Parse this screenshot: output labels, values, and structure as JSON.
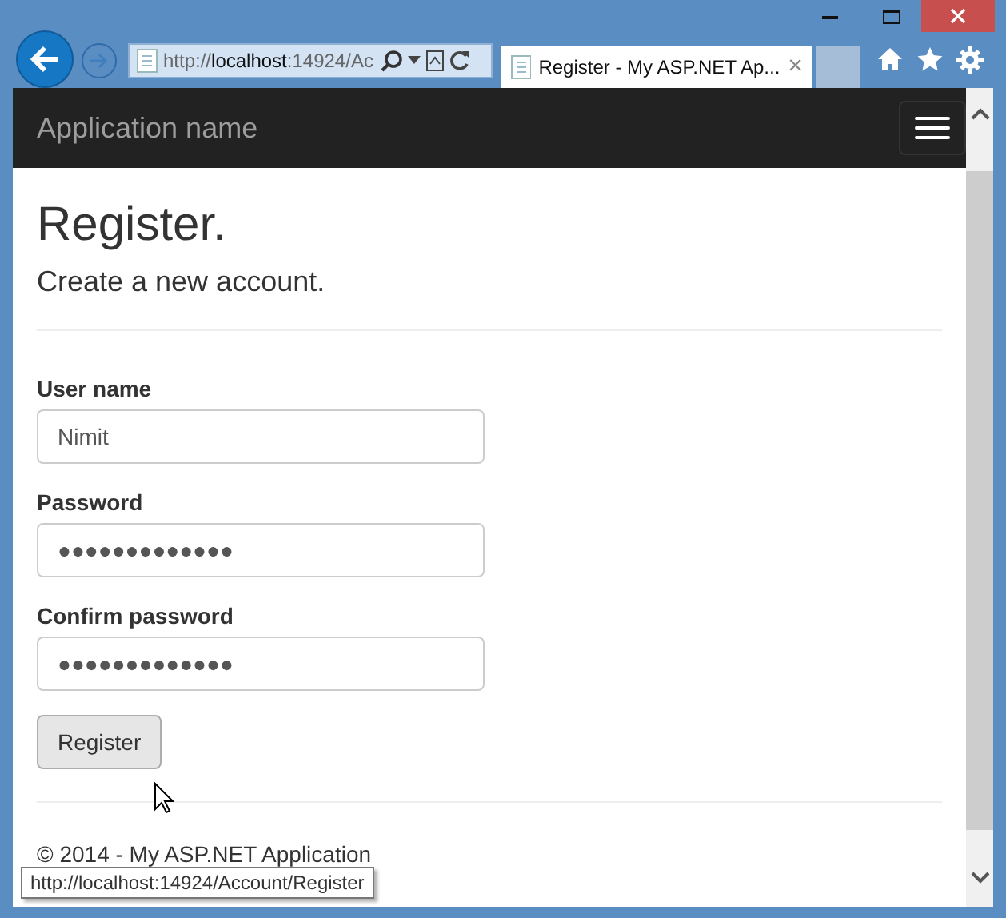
{
  "browser": {
    "address": "http://**localhost**:14924/Ac",
    "tab_title": "Register - My ASP.NET Ap...",
    "tab_close": "×",
    "status_url": "http://localhost:14924/Account/Register"
  },
  "navbar": {
    "brand": "Application name"
  },
  "page": {
    "title": "Register.",
    "subtitle": "Create a new account.",
    "fields": [
      {
        "label": "User name",
        "value": "Nimit"
      },
      {
        "label": "Password",
        "value": "●●●●●●●●●●●●●"
      },
      {
        "label": "Confirm password",
        "value": "●●●●●●●●●●●●●"
      }
    ],
    "submit": "Register",
    "footer": "© 2014 - My ASP.NET Application"
  }
}
